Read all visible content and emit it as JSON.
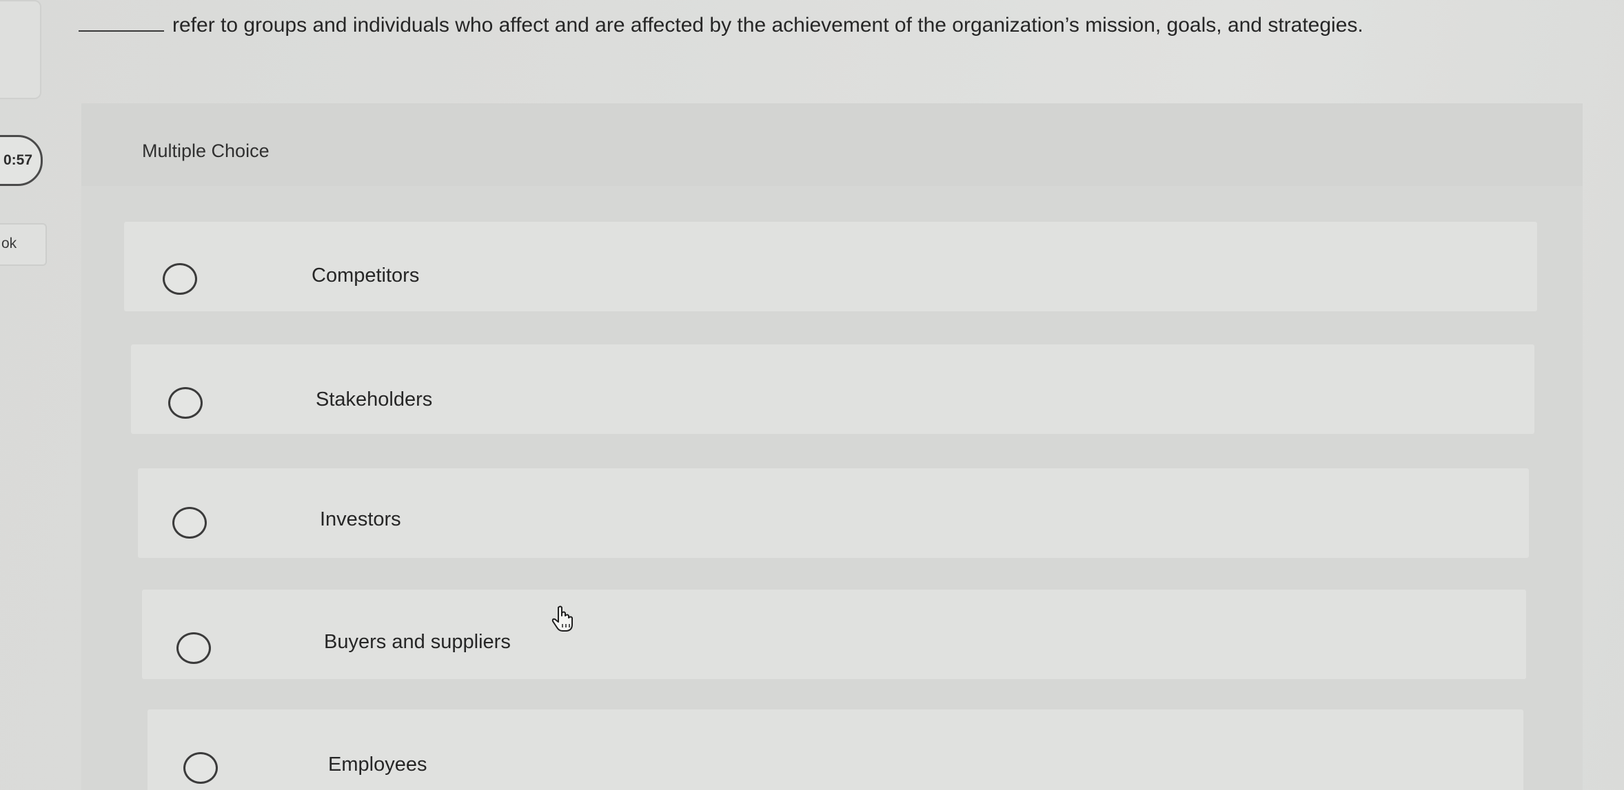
{
  "sidebar": {
    "timer": "0:57",
    "partial_label": "ok"
  },
  "question": {
    "text": "refer to groups and individuals who affect and are affected by the achievement of the organization’s mission, goals, and strategies."
  },
  "choices_panel": {
    "type_label": "Multiple Choice",
    "options": [
      {
        "label": "Competitors"
      },
      {
        "label": "Stakeholders"
      },
      {
        "label": "Investors"
      },
      {
        "label": "Buyers and suppliers"
      },
      {
        "label": "Employees"
      }
    ]
  },
  "cursor": {
    "icon": "hand-pointer-icon"
  }
}
